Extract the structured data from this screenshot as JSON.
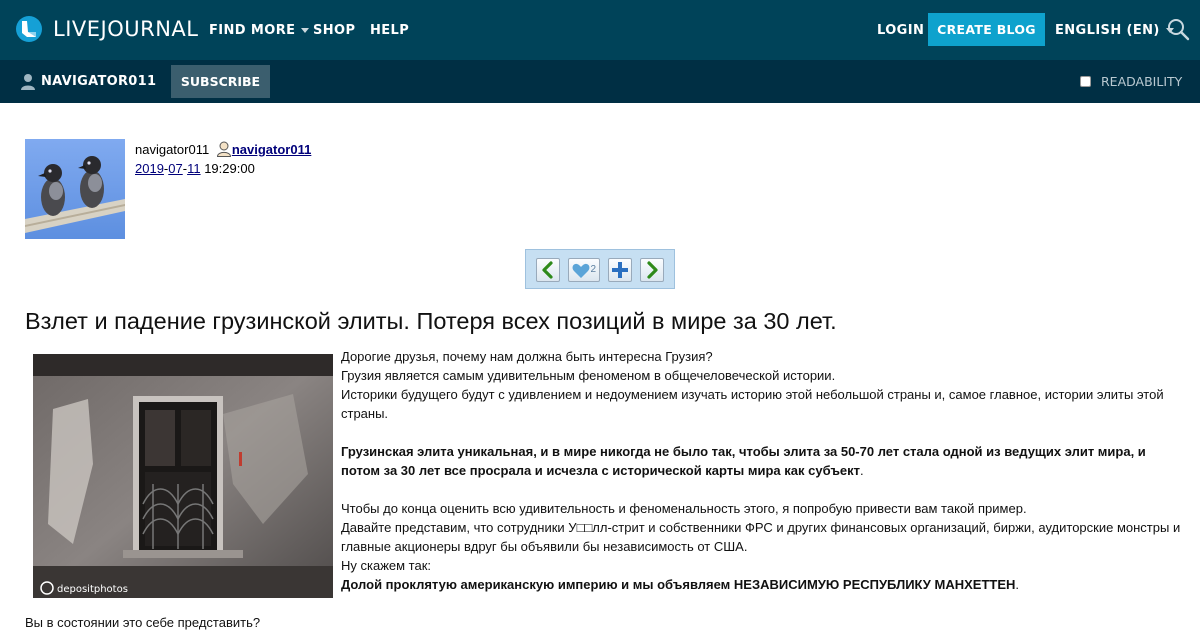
{
  "brand": {
    "name": "LIVEJOURNAL",
    "accent": "#0ea2cd",
    "topbar_bg": "#004359",
    "subbar_bg": "#002f44"
  },
  "nav": {
    "find_more": "FIND MORE",
    "shop": "SHOP",
    "help": "HELP",
    "login": "LOGIN",
    "create_blog": "CREATE BLOG",
    "language": "ENGLISH (EN)",
    "search_icon": "search-icon"
  },
  "journal_bar": {
    "username": "NAVIGATOR011",
    "subscribe": "SUBSCRIBE",
    "readability": "READABILITY"
  },
  "post": {
    "author_plain": "navigator011",
    "author_link": "navigator011",
    "date": {
      "year": "2019",
      "month": "07",
      "day": "11",
      "time": "19:29:00",
      "sep": "-"
    },
    "likes": "2",
    "title": "Взлет и падение грузинской элиты. Потеря всех позиций в мире за 30 лет.",
    "body": [
      "Дорогие друзья, почему нам должна быть интересна Грузия?",
      "Грузия является самым удивительным феноменом в общечеловеческой истории.",
      "Историки будущего будут с удивлением и недоумением изучать историю этой небольшой страны и, самое главное, истории элиты этой страны."
    ],
    "bold_paragraph": "Грузинская элита уникальная, и в мире никогда не было так, чтобы элита за 50-70 лет стала одной из ведущих элит мира, и потом за 30 лет все просрала и исчезла с исторической карты мира как субъект",
    "period": ".",
    "body2": [
      "Чтобы до конца оценить всю удивительность и феноменальность этого, я попробую привести вам такой пример.",
      "Давайте представим, что сотрудники У□□лл-стрит и собственники ФРС и других финансовых организаций, биржи, аудиторские монстры и главные акционеры вдруг бы объявили бы независимость от США.",
      "Ну скажем так:"
    ],
    "bold_line": "Долой проклятую американскую империю и мы объявляем НЕЗАВИСИМУЮ РЕСПУБЛИКУ МАНХЕТТЕН",
    "after": "Вы в состоянии это себе представить?",
    "image_watermark": "depositphotos"
  }
}
